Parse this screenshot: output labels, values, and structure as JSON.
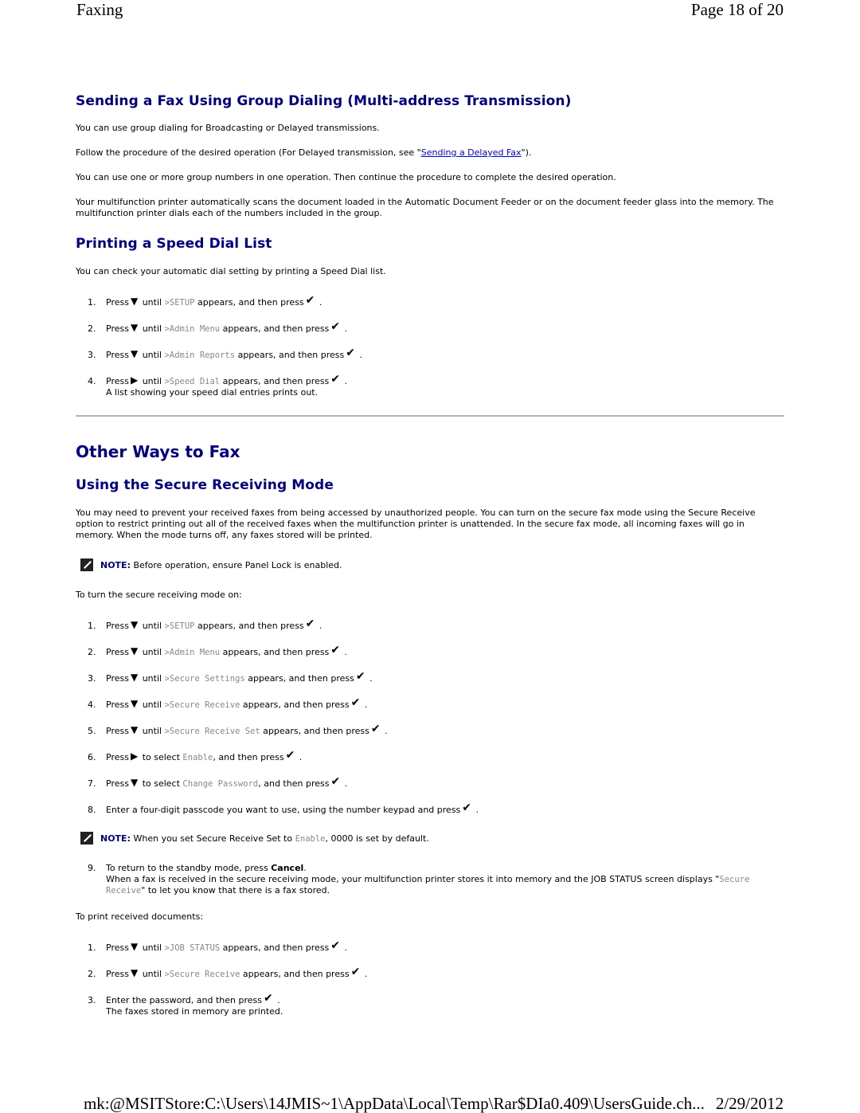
{
  "header": {
    "left": "Faxing",
    "right": "Page 18 of 20"
  },
  "footer": {
    "path": "mk:@MSITStore:C:\\Users\\14JMIS~1\\AppData\\Local\\Temp\\Rar$DIa0.409\\UsersGuide.ch...",
    "date": "2/29/2012"
  },
  "group_dialing": {
    "title": "Sending a Fax Using Group Dialing (Multi-address Transmission)",
    "p1": "You can use group dialing for Broadcasting or Delayed transmissions.",
    "p2_pre": "Follow the procedure of the desired operation (For Delayed transmission, see \"",
    "p2_link": "Sending a Delayed Fax",
    "p2_post": "\").",
    "p3": "You can use one or more group numbers in one operation. Then continue the procedure to complete the desired operation.",
    "p4": "Your multifunction printer automatically scans the document loaded in the Automatic Document Feeder or on the document feeder glass into the memory. The multifunction printer dials each of the numbers included in the group."
  },
  "speed_dial": {
    "title": "Printing a Speed Dial List",
    "intro": "You can check your automatic dial setting by printing a Speed Dial list.",
    "steps": [
      {
        "num": "1.",
        "press": "Press",
        "icon": "down-arrow",
        "until": "until",
        "code": ">SETUP",
        "rest": "appears, and then press"
      },
      {
        "num": "2.",
        "press": "Press",
        "icon": "down-arrow",
        "until": "until",
        "code": ">Admin Menu",
        "rest": "appears, and then press"
      },
      {
        "num": "3.",
        "press": "Press",
        "icon": "down-arrow",
        "until": "until",
        "code": ">Admin Reports",
        "rest": "appears, and then press"
      },
      {
        "num": "4.",
        "press": "Press",
        "icon": "right-arrow",
        "until": "until",
        "code": ">Speed Dial",
        "rest": "appears, and then press",
        "sub": "A list showing your speed dial entries prints out."
      }
    ]
  },
  "other_ways": {
    "title": "Other Ways to Fax"
  },
  "secure_receive": {
    "title": "Using the Secure Receiving Mode",
    "intro": "You may need to prevent your received faxes from being accessed by unauthorized people. You can turn on the secure fax mode using the Secure Receive option to restrict printing out all of the received faxes when the multifunction printer is unattended. In the secure fax mode, all incoming faxes will go in memory. When the mode turns off, any faxes stored will be printed.",
    "note1_label": "NOTE:",
    "note1_text": "Before operation, ensure Panel Lock is enabled.",
    "turn_on_intro": "To turn the secure receiving mode on:",
    "steps": [
      {
        "num": "1.",
        "press": "Press",
        "icon": "down-arrow",
        "until": "until",
        "code": ">SETUP",
        "rest": "appears, and then press"
      },
      {
        "num": "2.",
        "press": "Press",
        "icon": "down-arrow",
        "until": "until",
        "code": ">Admin Menu",
        "rest": "appears, and then press"
      },
      {
        "num": "3.",
        "press": "Press",
        "icon": "down-arrow",
        "until": "until",
        "code": ">Secure Settings",
        "rest": "appears, and then press"
      },
      {
        "num": "4.",
        "press": "Press",
        "icon": "down-arrow",
        "until": "until",
        "code": ">Secure Receive",
        "rest": "appears, and then press"
      },
      {
        "num": "5.",
        "press": "Press",
        "icon": "down-arrow",
        "until": "until",
        "code": ">Secure Receive Set",
        "rest": "appears, and then press"
      },
      {
        "num": "6.",
        "press": "Press",
        "icon": "right-arrow",
        "until": "to select",
        "code": "Enable",
        "rest": ", and then press"
      },
      {
        "num": "7.",
        "press": "Press",
        "icon": "down-arrow",
        "until": "to select",
        "code": "Change Password",
        "rest": ", and then press"
      },
      {
        "num": "8.",
        "text": "Enter a four-digit passcode you want to use, using the number keypad and press"
      }
    ],
    "note2_label": "NOTE:",
    "note2_pre": "When you set Secure Receive Set to",
    "note2_code": "Enable",
    "note2_post": ", 0000 is set by default.",
    "step9": {
      "num": "9.",
      "pre": "To return to the standby mode, press",
      "bold": "Cancel",
      "post": ".",
      "sub_pre": "When a fax is received in the secure receiving mode, your multifunction printer stores it into memory and the JOB STATUS screen displays \"",
      "sub_code": "Secure Receive",
      "sub_post": "\" to let you know that there is a fax stored."
    },
    "print_intro": "To print received documents:",
    "print_steps": [
      {
        "num": "1.",
        "press": "Press",
        "icon": "down-arrow",
        "until": "until",
        "code": ">JOB STATUS",
        "rest": "appears, and then press"
      },
      {
        "num": "2.",
        "press": "Press",
        "icon": "down-arrow",
        "until": "until",
        "code": ">Secure Receive",
        "rest": "appears, and then press"
      },
      {
        "num": "3.",
        "text": "Enter the password, and then press",
        "sub": "The faxes stored in memory are printed."
      }
    ]
  },
  "icons": {
    "down-arrow": "▼",
    "right-arrow": "▶",
    "check": "✔"
  }
}
